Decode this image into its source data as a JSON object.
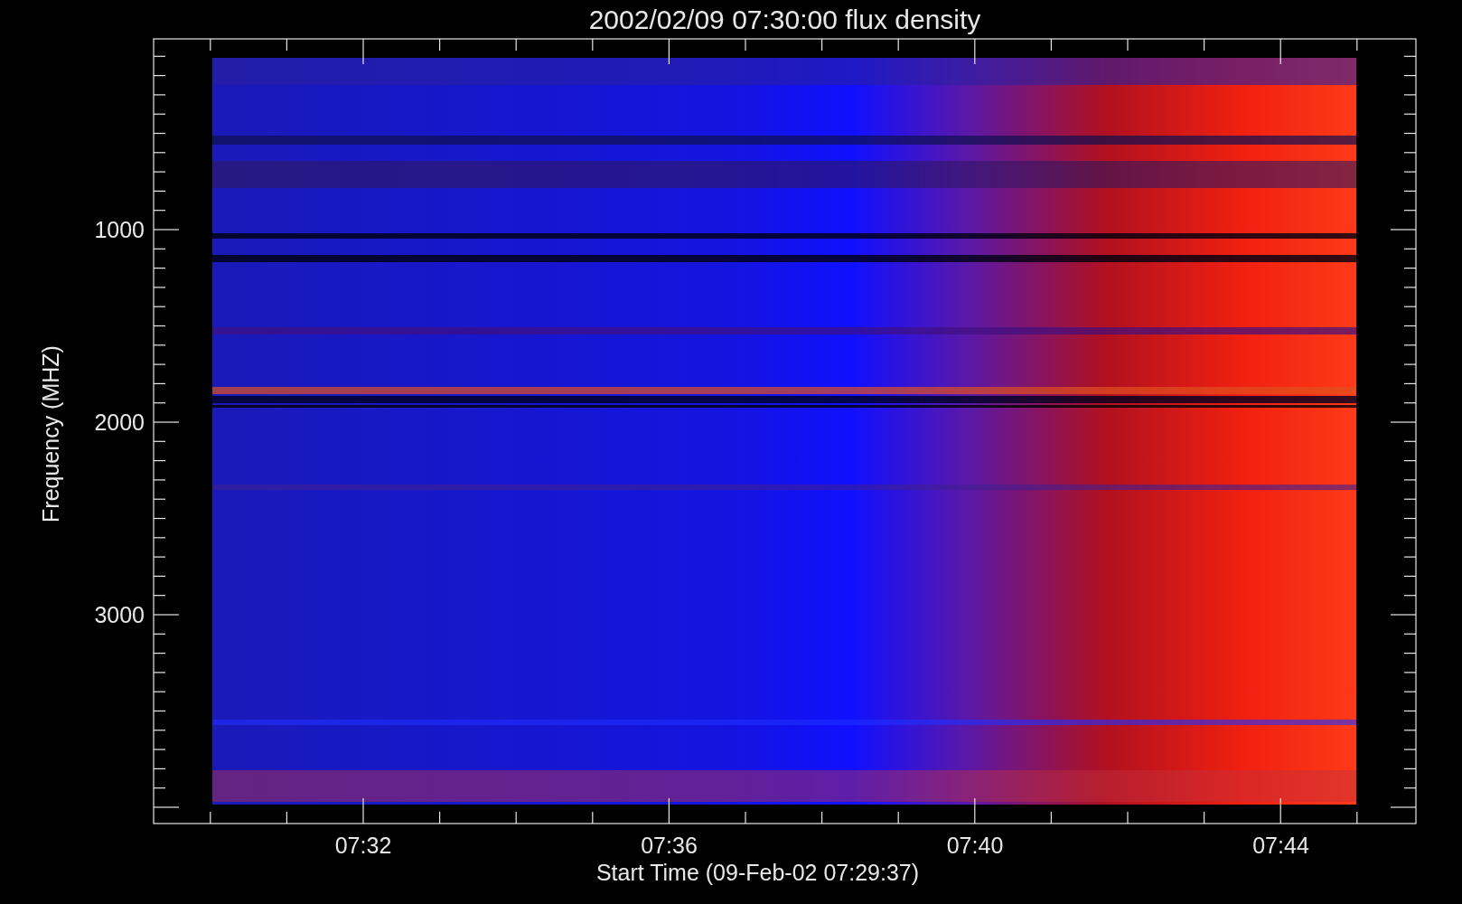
{
  "title": "2002/02/09 07:30:00 flux density",
  "y_axis": {
    "label": "Frequency (MHZ)",
    "ticks": [
      "1000",
      "2000",
      "3000"
    ]
  },
  "x_axis": {
    "label": "Start Time (09-Feb-02 07:29:37)",
    "ticks": [
      "07:32",
      "07:36",
      "07:40",
      "07:44"
    ]
  }
}
